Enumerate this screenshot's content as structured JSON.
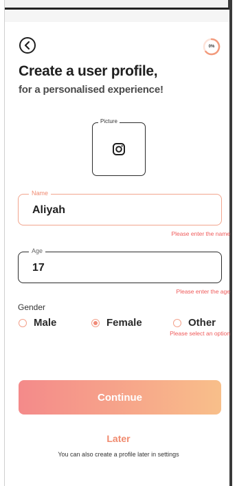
{
  "header": {
    "progress_label": "0%",
    "progress_value": 0
  },
  "title": "Create a user profile,",
  "subtitle": "for a personalised experience!",
  "picture": {
    "legend": "Picture"
  },
  "name_field": {
    "legend": "Name",
    "value": "Aliyah",
    "error": "Please enter the name"
  },
  "age_field": {
    "legend": "Age",
    "value": "17",
    "error": "Please enter the age"
  },
  "gender": {
    "label": "Gender",
    "options": [
      "Male",
      "Female",
      "Other"
    ],
    "selected": "Female",
    "error": "Please select an option"
  },
  "actions": {
    "continue_label": "Continue",
    "later_label": "Later",
    "later_hint": "You can also create a profile later in settings"
  },
  "colors": {
    "accent": "#f08a70",
    "error": "#ef5a5a",
    "button_start": "#f48a8a",
    "button_end": "#f8bf8a"
  },
  "icons": {
    "back": "back-arrow-circle-icon",
    "picture": "instagram-camera-icon"
  }
}
